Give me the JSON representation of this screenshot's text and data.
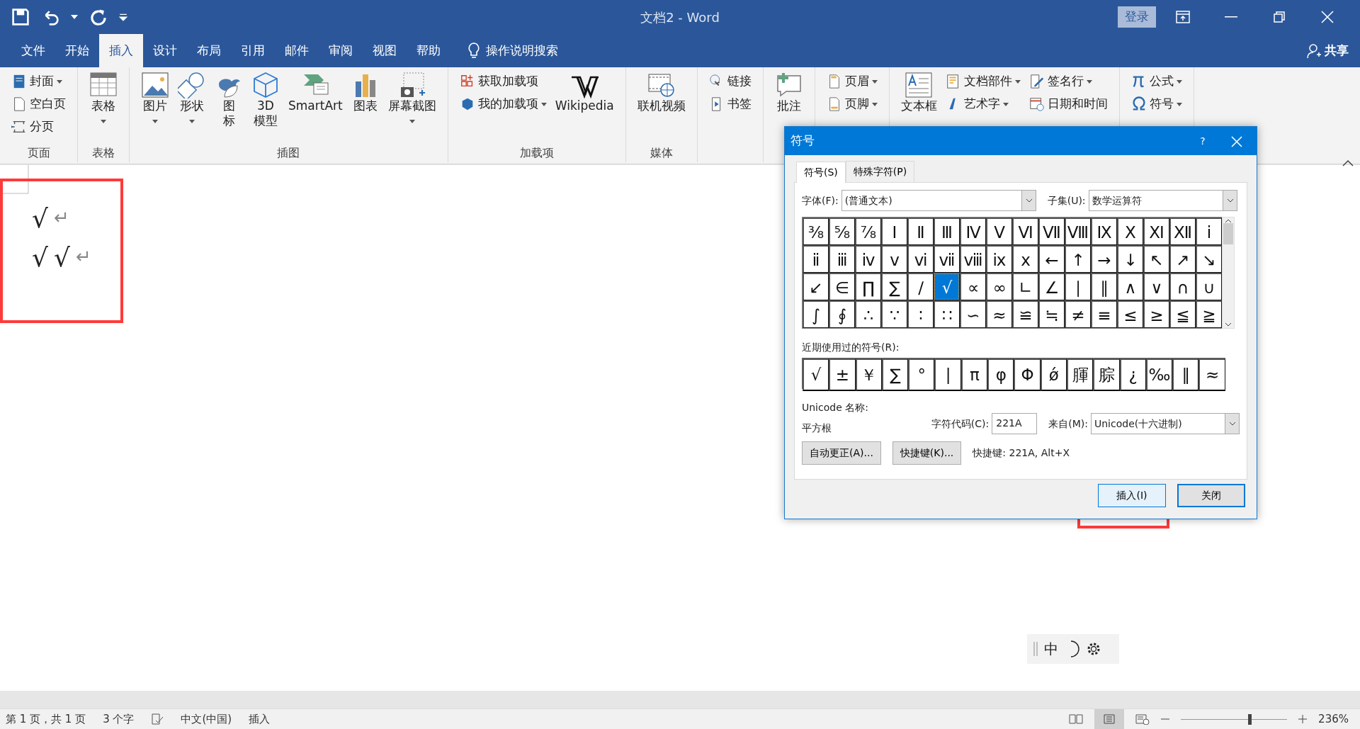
{
  "window": {
    "title": "文档2  -  Word",
    "sign_in": "登录"
  },
  "tabs": [
    {
      "label": "文件",
      "selected": false
    },
    {
      "label": "开始",
      "selected": false
    },
    {
      "label": "插入",
      "selected": true
    },
    {
      "label": "设计",
      "selected": false
    },
    {
      "label": "布局",
      "selected": false
    },
    {
      "label": "引用",
      "selected": false
    },
    {
      "label": "邮件",
      "selected": false
    },
    {
      "label": "审阅",
      "selected": false
    },
    {
      "label": "视图",
      "selected": false
    },
    {
      "label": "帮助",
      "selected": false
    }
  ],
  "tell_me": "操作说明搜索",
  "share": "共享",
  "ribbon": [
    {
      "label": "页面",
      "columns": [
        {
          "kind": "stack",
          "items": [
            {
              "label": "封面",
              "dropdown": true
            },
            {
              "label": "空白页",
              "dropdown": false
            },
            {
              "label": "分页",
              "dropdown": false
            }
          ]
        }
      ]
    },
    {
      "label": "表格",
      "columns": [
        {
          "kind": "big",
          "items": [
            {
              "label": "表格",
              "dropdown": true
            }
          ]
        }
      ]
    },
    {
      "label": "插图",
      "columns": [
        {
          "kind": "big",
          "items": [
            {
              "label": "图片",
              "dropdown": true
            }
          ]
        },
        {
          "kind": "big",
          "items": [
            {
              "label": "形状",
              "dropdown": true
            }
          ]
        },
        {
          "kind": "narrow",
          "items": [
            {
              "label": "图标",
              "dropdown": false
            }
          ]
        },
        {
          "kind": "narrow2",
          "items": [
            {
              "label": "3D 模型",
              "dropdown": false
            }
          ]
        },
        {
          "kind": "big",
          "items": [
            {
              "label": "SmartArt",
              "dropdown": false
            }
          ]
        },
        {
          "kind": "big",
          "items": [
            {
              "label": "图表",
              "dropdown": false
            }
          ]
        },
        {
          "kind": "big",
          "items": [
            {
              "label": "屏幕截图",
              "dropdown": true
            }
          ]
        }
      ]
    },
    {
      "label": "加载项",
      "columns": [
        {
          "kind": "stack",
          "items": [
            {
              "label": "获取加载项",
              "dropdown": false
            },
            {
              "label": "我的加载项",
              "dropdown": true
            }
          ]
        },
        {
          "kind": "big",
          "items": [
            {
              "label": "Wikipedia",
              "dropdown": false
            }
          ]
        }
      ]
    },
    {
      "label": "媒体",
      "columns": [
        {
          "kind": "big",
          "items": [
            {
              "label": "联机视频",
              "dropdown": false
            }
          ]
        }
      ]
    },
    {
      "columns": [
        {
          "kind": "stack",
          "items": [
            {
              "label": "链接",
              "dropdown": false
            },
            {
              "label": "书签",
              "dropdown": false
            }
          ]
        }
      ]
    },
    {
      "columns": [
        {
          "kind": "big",
          "items": [
            {
              "label": "批注",
              "dropdown": false
            }
          ]
        }
      ]
    },
    {
      "columns": [
        {
          "kind": "stack",
          "items": [
            {
              "label": "页眉",
              "dropdown": true
            },
            {
              "label": "页脚",
              "dropdown": true
            }
          ]
        }
      ]
    },
    {
      "columns": [
        {
          "kind": "big",
          "items": [
            {
              "label": "文本框",
              "dropdown": false
            }
          ]
        },
        {
          "kind": "stack",
          "items": [
            {
              "label": "文档部件",
              "dropdown": true
            },
            {
              "label": "艺术字",
              "dropdown": true
            }
          ]
        },
        {
          "kind": "stack",
          "items": [
            {
              "label": "签名行",
              "dropdown": true
            },
            {
              "label": "日期和时间",
              "dropdown": false
            }
          ]
        }
      ]
    },
    {
      "columns": [
        {
          "kind": "stack",
          "items": [
            {
              "label": "公式",
              "dropdown": true
            },
            {
              "label": "符号",
              "dropdown": true
            }
          ]
        }
      ]
    }
  ],
  "document": {
    "lines": [
      {
        "chars": [
          "√"
        ],
        "end_mark": "↵"
      },
      {
        "chars": [
          "√",
          "√"
        ],
        "end_mark": "↵"
      }
    ]
  },
  "dialog": {
    "title": "符号",
    "help": "?",
    "tabs": [
      {
        "label": "符号(S)",
        "selected": true
      },
      {
        "label": "特殊字符(P)",
        "selected": false
      }
    ],
    "font_label": "字体(F):",
    "font_value": "(普通文本)",
    "subset_label": "子集(U):",
    "subset_value": "数学运算符",
    "grid": [
      [
        {
          "char": "⅜",
          "selected": false
        },
        {
          "char": "⅝",
          "selected": false
        },
        {
          "char": "⅞",
          "selected": false
        },
        {
          "char": "Ⅰ",
          "selected": false
        },
        {
          "char": "Ⅱ",
          "selected": false
        },
        {
          "char": "Ⅲ",
          "selected": false
        },
        {
          "char": "Ⅳ",
          "selected": false
        },
        {
          "char": "Ⅴ",
          "selected": false
        },
        {
          "char": "Ⅵ",
          "selected": false
        },
        {
          "char": "Ⅶ",
          "selected": false
        },
        {
          "char": "Ⅷ",
          "selected": false
        },
        {
          "char": "Ⅸ",
          "selected": false
        },
        {
          "char": "Ⅹ",
          "selected": false
        },
        {
          "char": "Ⅺ",
          "selected": false
        },
        {
          "char": "Ⅻ",
          "selected": false
        },
        {
          "char": "ⅰ",
          "selected": false
        }
      ],
      [
        {
          "char": "ⅱ",
          "selected": false
        },
        {
          "char": "ⅲ",
          "selected": false
        },
        {
          "char": "ⅳ",
          "selected": false
        },
        {
          "char": "ⅴ",
          "selected": false
        },
        {
          "char": "ⅵ",
          "selected": false
        },
        {
          "char": "ⅶ",
          "selected": false
        },
        {
          "char": "ⅷ",
          "selected": false
        },
        {
          "char": "ⅸ",
          "selected": false
        },
        {
          "char": "ⅹ",
          "selected": false
        },
        {
          "char": "←",
          "selected": false
        },
        {
          "char": "↑",
          "selected": false
        },
        {
          "char": "→",
          "selected": false
        },
        {
          "char": "↓",
          "selected": false
        },
        {
          "char": "↖",
          "selected": false
        },
        {
          "char": "↗",
          "selected": false
        },
        {
          "char": "↘",
          "selected": false
        }
      ],
      [
        {
          "char": "↙",
          "selected": false
        },
        {
          "char": "∈",
          "selected": false
        },
        {
          "char": "∏",
          "selected": false
        },
        {
          "char": "∑",
          "selected": false
        },
        {
          "char": "∕",
          "selected": false
        },
        {
          "char": "√",
          "selected": true
        },
        {
          "char": "∝",
          "selected": false
        },
        {
          "char": "∞",
          "selected": false
        },
        {
          "char": "∟",
          "selected": false
        },
        {
          "char": "∠",
          "selected": false
        },
        {
          "char": "∣",
          "selected": false
        },
        {
          "char": "∥",
          "selected": false
        },
        {
          "char": "∧",
          "selected": false
        },
        {
          "char": "∨",
          "selected": false
        },
        {
          "char": "∩",
          "selected": false
        },
        {
          "char": "∪",
          "selected": false
        }
      ],
      [
        {
          "char": "∫",
          "selected": false
        },
        {
          "char": "∮",
          "selected": false
        },
        {
          "char": "∴",
          "selected": false
        },
        {
          "char": "∵",
          "selected": false
        },
        {
          "char": "∶",
          "selected": false
        },
        {
          "char": "∷",
          "selected": false
        },
        {
          "char": "∽",
          "selected": false
        },
        {
          "char": "≈",
          "selected": false
        },
        {
          "char": "≌",
          "selected": false
        },
        {
          "char": "≒",
          "selected": false
        },
        {
          "char": "≠",
          "selected": false
        },
        {
          "char": "≡",
          "selected": false
        },
        {
          "char": "≤",
          "selected": false
        },
        {
          "char": "≥",
          "selected": false
        },
        {
          "char": "≦",
          "selected": false
        },
        {
          "char": "≧",
          "selected": false
        }
      ]
    ],
    "recent_label": "近期使用过的符号(R):",
    "recent": [
      "√",
      "±",
      "￥",
      "∑",
      "°",
      "|",
      "π",
      "φ",
      "Φ",
      "ǿ",
      "腪",
      "腙",
      "¿",
      "‰",
      "‖",
      "≈"
    ],
    "unicode_name_label": "Unicode 名称:",
    "unicode_name": "平方根",
    "code_label": "字符代码(C):",
    "code_value": "221A",
    "from_label": "来自(M):",
    "from_value": "Unicode(十六进制)",
    "autocorrect": "自动更正(A)...",
    "shortcut_button": "快捷键(K)...",
    "shortcut_text": "快捷键: 221A, Alt+X",
    "insert": "插入(I)",
    "close": "关闭"
  },
  "ime_bar": {
    "label": "中"
  },
  "status_bar": {
    "page": "第 1 页，共 1 页",
    "words": "3 个字",
    "language": "中文(中国)",
    "mode": "插入",
    "zoom": "236%",
    "zoom_slider": {
      "level": 0.63
    }
  }
}
